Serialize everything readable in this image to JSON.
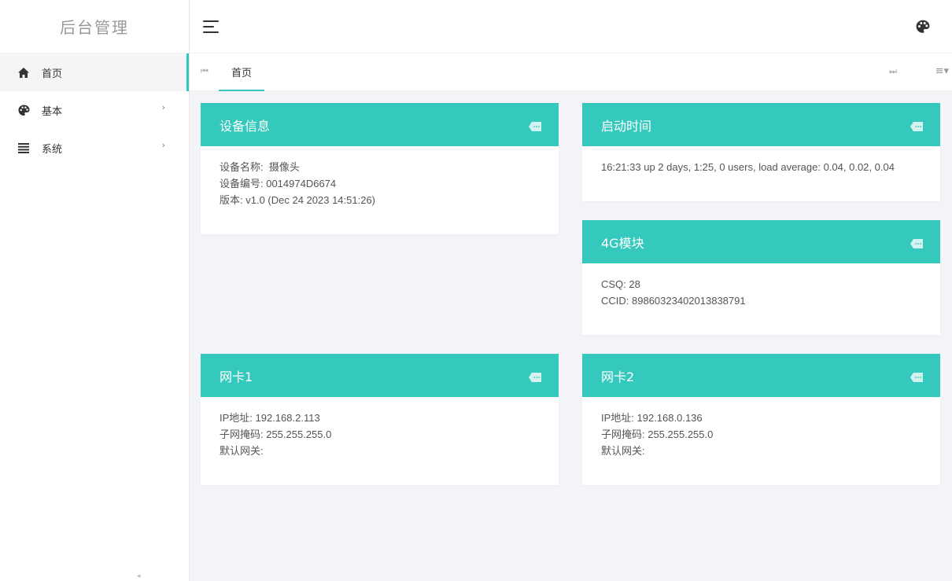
{
  "app": {
    "title": "后台管理"
  },
  "sidebar": {
    "items": [
      {
        "label": "首页",
        "icon": "home-icon",
        "active": true,
        "has_children": false
      },
      {
        "label": "基本",
        "icon": "palette-icon",
        "active": false,
        "has_children": true
      },
      {
        "label": "系统",
        "icon": "list-icon",
        "active": false,
        "has_children": true
      }
    ]
  },
  "tabs": [
    {
      "label": "首页",
      "active": true
    }
  ],
  "colors": {
    "accent": "#35c8bc",
    "background": "#f3f4f8"
  },
  "cards": {
    "device": {
      "title": "设备信息",
      "lines": [
        "设备名称:  摄像头",
        "设备编号: 0014974D6674",
        "版本: v1.0 (Dec 24 2023 14:51:26)"
      ]
    },
    "uptime": {
      "title": "启动时间",
      "lines": [
        "16:21:33 up 2 days, 1:25, 0 users, load average: 0.04, 0.02, 0.04"
      ]
    },
    "modem": {
      "title": "4G模块",
      "lines": [
        "CSQ: 28",
        "CCID: 89860323402013838791"
      ]
    },
    "nic1": {
      "title": "网卡1",
      "lines": [
        "IP地址: 192.168.2.113",
        "子网掩码: 255.255.255.0",
        "默认网关:"
      ]
    },
    "nic2": {
      "title": "网卡2",
      "lines": [
        "IP地址: 192.168.0.136",
        "子网掩码: 255.255.255.0",
        "默认网关:"
      ]
    }
  }
}
